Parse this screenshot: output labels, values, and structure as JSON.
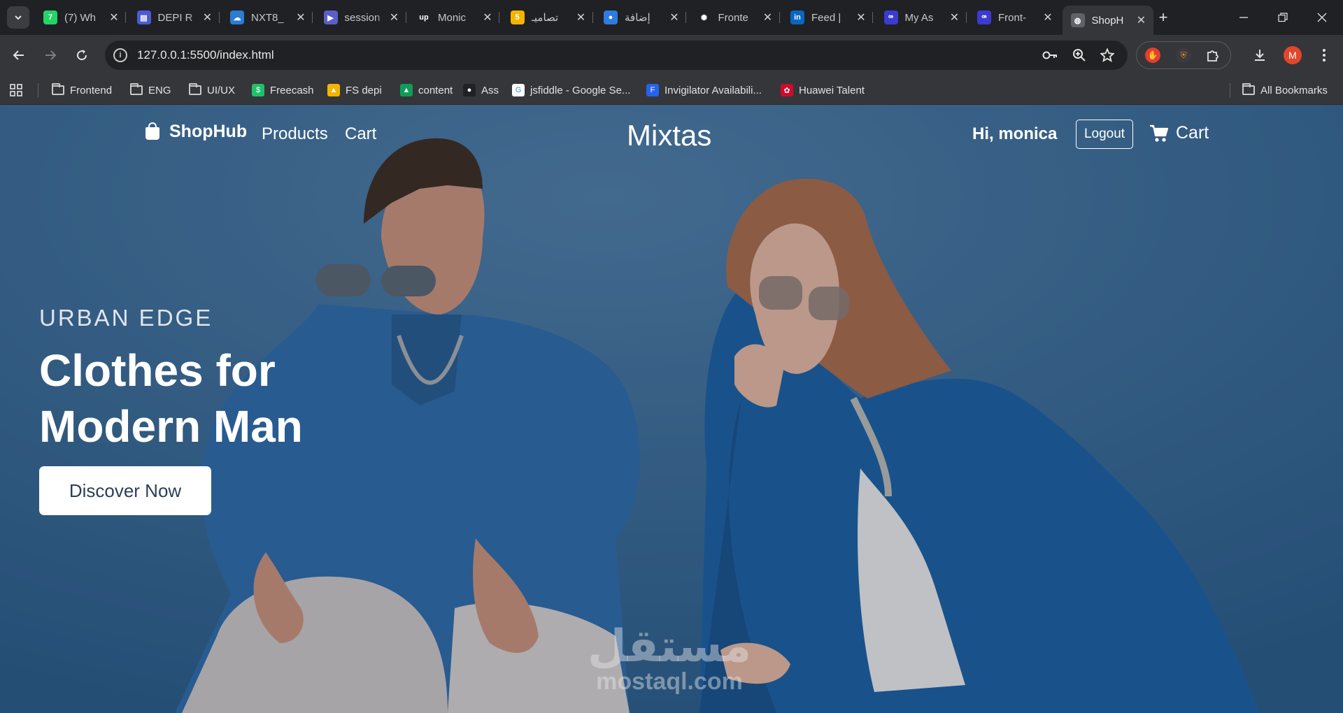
{
  "tabs": [
    {
      "title": "(7) Wh",
      "fav_color": "#25d366",
      "fav_glyph": "7"
    },
    {
      "title": "DEPI R",
      "fav_color": "#4c5bd4",
      "fav_glyph": "▤"
    },
    {
      "title": "NXT8_",
      "fav_color": "#2b7cd3",
      "fav_glyph": "☁"
    },
    {
      "title": "session",
      "fav_color": "#5b5fc7",
      "fav_glyph": "▶"
    },
    {
      "title": "Monic",
      "fav_color": "#202124",
      "fav_glyph": "up"
    },
    {
      "title": "تصاميـ",
      "fav_color": "#f5b400",
      "fav_glyph": "5"
    },
    {
      "title": "إضافة",
      "fav_color": "#2f7be0",
      "fav_glyph": "●"
    },
    {
      "title": "Fronte",
      "fav_color": "#202124",
      "fav_glyph": "✺"
    },
    {
      "title": "Feed |",
      "fav_color": "#0a66c2",
      "fav_glyph": "in"
    },
    {
      "title": "My As",
      "fav_color": "#3b3bd1",
      "fav_glyph": "ꟹ"
    },
    {
      "title": "Front-",
      "fav_color": "#3b3bd1",
      "fav_glyph": "ꟹ"
    },
    {
      "title": "ShopH",
      "fav_color": "#5f6368",
      "fav_glyph": "◍"
    }
  ],
  "address": {
    "url": "127.0.0.1:5500/index.html"
  },
  "bookmarks": [
    {
      "label": "Frontend",
      "type": "folder"
    },
    {
      "label": "ENG",
      "type": "folder"
    },
    {
      "label": "UI/UX",
      "type": "folder"
    },
    {
      "label": "Freecash",
      "type": "site",
      "color": "#21c06b",
      "glyph": "$"
    },
    {
      "label": "FS depi",
      "type": "site",
      "color": "#f4b400",
      "glyph": "▲"
    },
    {
      "label": "content",
      "type": "site",
      "color": "#0f9d58",
      "glyph": "▲"
    },
    {
      "label": "Ass",
      "type": "site",
      "color": "#202124",
      "glyph": "●"
    },
    {
      "label": "jsfiddle - Google Se...",
      "type": "site",
      "color": "#ffffff",
      "glyph": "G"
    },
    {
      "label": "Invigilator Availabili...",
      "type": "site",
      "color": "#2563eb",
      "glyph": "F"
    },
    {
      "label": "Huawei Talent",
      "type": "site",
      "color": "#cf0a2c",
      "glyph": "✿"
    }
  ],
  "all_bookmarks": "All Bookmarks",
  "profile_initial": "M",
  "site": {
    "brand": "ShopHub",
    "nav_products": "Products",
    "nav_cart": "Cart",
    "logo": "Mixtas",
    "greeting": "Hi, monica",
    "logout": "Logout",
    "cart": "Cart"
  },
  "hero": {
    "kicker": "URBAN EDGE",
    "title_line1": "Clothes for",
    "title_line2": "Modern Man",
    "cta": "Discover Now"
  },
  "watermark": {
    "arabic": "مستقل",
    "latin": "mostaql.com"
  },
  "colors": {
    "page_blue": "#2f5f8a",
    "chrome_dark": "#202124",
    "chrome_mid": "#35363a"
  }
}
